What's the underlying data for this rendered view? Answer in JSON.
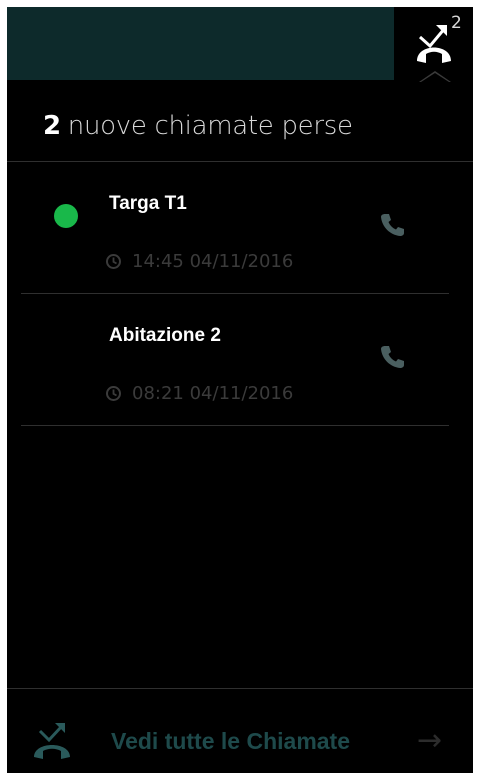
{
  "topbar": {
    "missed_icon": "missed-call-icon",
    "missed_badge": "2"
  },
  "header": {
    "count": "2",
    "text": "nuove chiamate perse"
  },
  "calls": [
    {
      "name": "Targa T1",
      "time": "14:45 04/11/2016",
      "online": true,
      "status_color": "#19b84a",
      "action_icon": "phone-icon"
    },
    {
      "name": "Abitazione 2",
      "time": "08:21 04/11/2016",
      "online": false,
      "action_icon": "phone-icon"
    }
  ],
  "footer": {
    "icon": "missed-call-icon",
    "label": "Vedi tutte le Chiamate",
    "arrow": "→"
  },
  "colors": {
    "background": "#000000",
    "topbar": "#0d2a2b",
    "accent": "#1e4a4b",
    "online": "#19b84a"
  }
}
